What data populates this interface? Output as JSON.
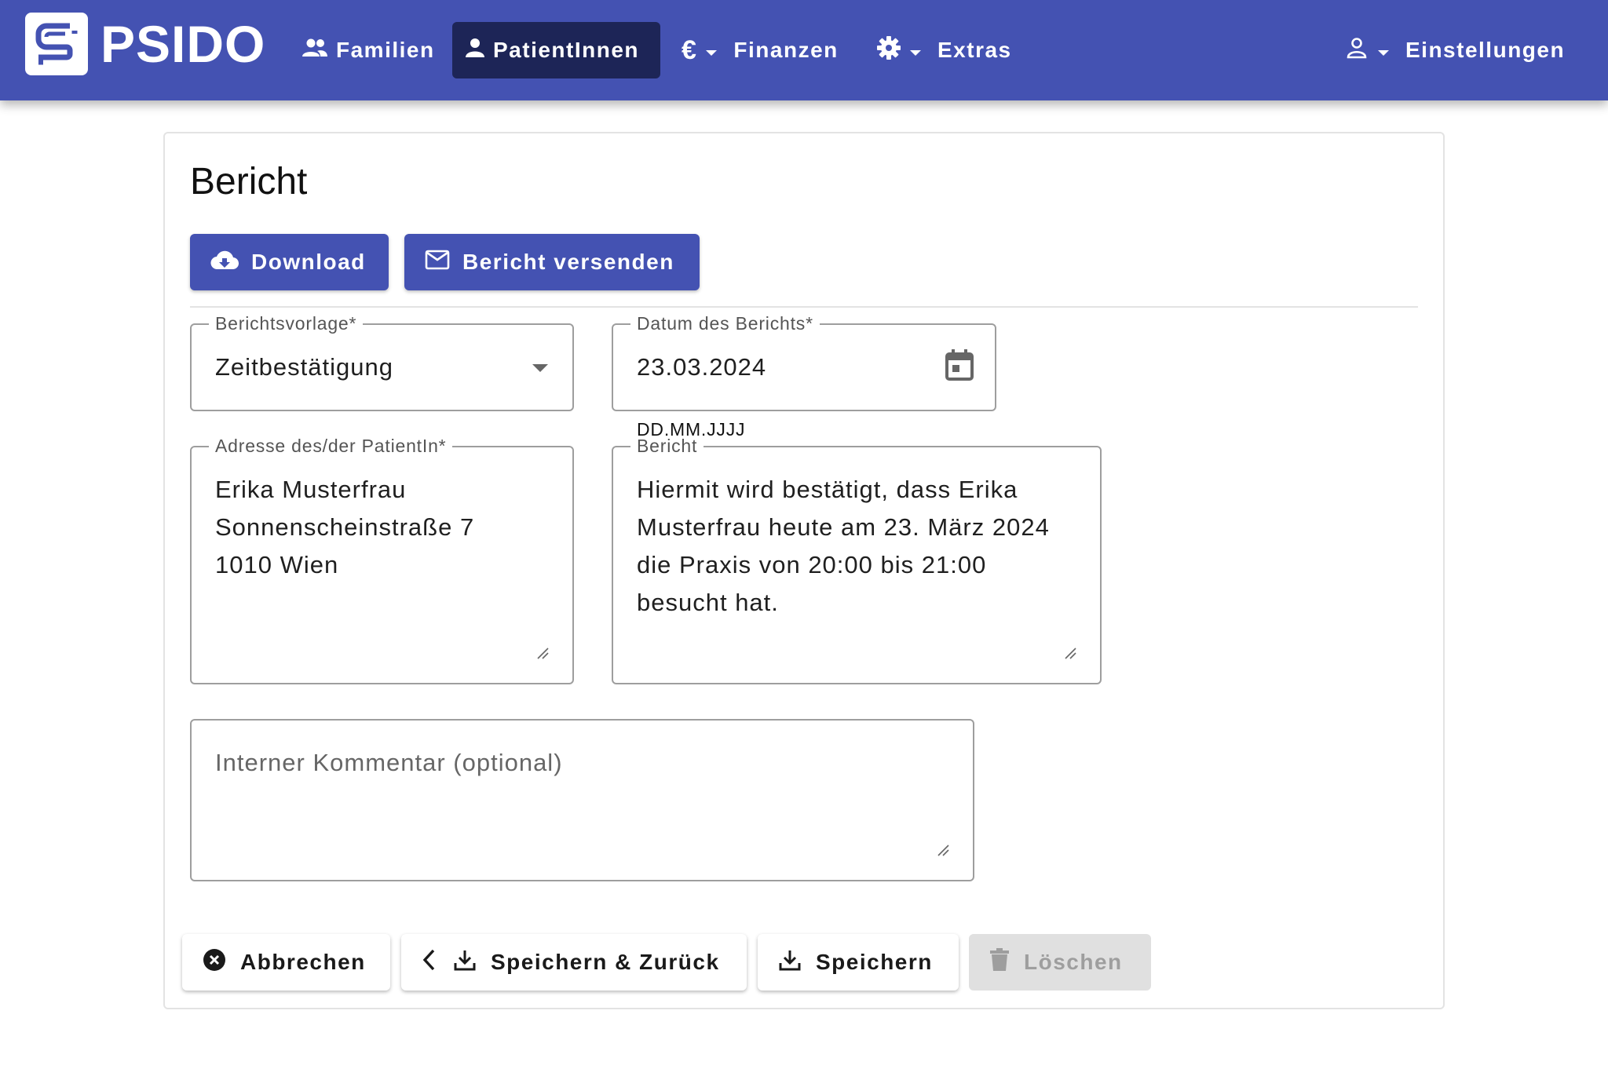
{
  "app": {
    "name": "PSIDO"
  },
  "nav": {
    "items": [
      {
        "label": "Familien",
        "icon": "people-icon",
        "active": false
      },
      {
        "label": "PatientInnen",
        "icon": "person-icon",
        "active": true
      },
      {
        "label": "Finanzen",
        "icon": "euro-icon",
        "active": false
      },
      {
        "label": "Extras",
        "icon": "gear-icon",
        "active": false
      },
      {
        "label": "Einstellungen",
        "icon": "account-icon",
        "active": false
      }
    ]
  },
  "page": {
    "title": "Bericht"
  },
  "actions": {
    "download_label": "Download",
    "send_label": "Bericht versenden"
  },
  "form": {
    "template": {
      "label": "Berichtsvorlage*",
      "value": "Zeitbestätigung"
    },
    "date": {
      "label": "Datum des Berichts*",
      "value": "23.03.2024",
      "hint": "DD.MM.JJJJ"
    },
    "address": {
      "label": "Adresse des/der PatientIn*",
      "value": "Erika Musterfrau\nSonnenscheinstraße 7\n1010 Wien"
    },
    "report": {
      "label": "Bericht",
      "value": "Hiermit wird bestätigt, dass Erika\nMusterfrau heute am 23. März 2024\ndie Praxis von 20:00 bis 21:00\nbesucht hat."
    },
    "comment": {
      "placeholder": "Interner Kommentar (optional)"
    }
  },
  "footer": {
    "cancel_label": "Abbrechen",
    "save_back_label": "Speichern & Zurück",
    "save_label": "Speichern",
    "delete_label": "Löschen",
    "delete_enabled": false
  },
  "colors": {
    "primary": "#4452b2",
    "nav_active": "#1d2557",
    "disabled": "#e0e0e0"
  }
}
